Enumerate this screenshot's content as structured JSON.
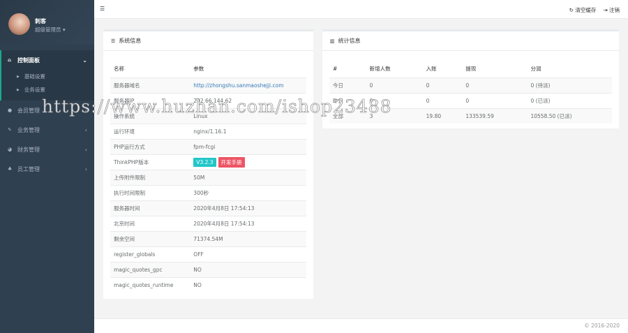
{
  "sidebar": {
    "user_name": "刺客",
    "user_role": "超级管理员 ▾",
    "menu": [
      {
        "label": "控制面板",
        "icon": "home-icon"
      },
      {
        "label": "会员管理",
        "icon": "user-icon"
      },
      {
        "label": "业务管理",
        "icon": "edit-icon"
      },
      {
        "label": "财务管理",
        "icon": "pie-chart-icon"
      },
      {
        "label": "员工管理",
        "icon": "sitemap-icon"
      }
    ],
    "submenu": [
      {
        "label": "基础设置"
      },
      {
        "label": "业务设置"
      }
    ]
  },
  "topbar": {
    "toggle": "☰",
    "clear_cache": "清空缓存",
    "logout": "注销"
  },
  "system_info": {
    "title": "系统信息",
    "headers": [
      "名称",
      "参数"
    ],
    "rows": [
      [
        "服务器域名",
        "http://zhongshu.sanmaoshejji.com"
      ],
      [
        "服务器IP",
        "202.66.144.62"
      ],
      [
        "操作系统",
        "Linux"
      ],
      [
        "运行环境",
        "nginx/1.16.1"
      ],
      [
        "PHP运行方式",
        "fpm-fcgi"
      ],
      [
        "ThinkPHP版本",
        ""
      ],
      [
        "上传附件限制",
        "50M"
      ],
      [
        "执行时间限制",
        "300秒"
      ],
      [
        "服务器时间",
        "2020年4月8日 17:54:13"
      ],
      [
        "北京时间",
        "2020年4月8日 17:54:13"
      ],
      [
        "剩余空间",
        "71374.54M"
      ],
      [
        "register_globals",
        "OFF"
      ],
      [
        "magic_quotes_gpc",
        "NO"
      ],
      [
        "magic_quotes_runtime",
        "NO"
      ]
    ],
    "version_badge": "V3.2.3",
    "manual_badge": "开发手册"
  },
  "stats": {
    "title": "统计信息",
    "headers": [
      "#",
      "新增人数",
      "入账",
      "提现",
      "分润"
    ],
    "rows": [
      [
        "今日",
        "0",
        "0",
        "0",
        "0 (待派)"
      ],
      [
        "昨日",
        "0",
        "0",
        "0",
        "0 (已派)"
      ],
      [
        "全部",
        "3",
        "19.80",
        "133539.59",
        "10558.50 (已派)"
      ]
    ]
  },
  "footer": {
    "copyright": "© 2016-2020"
  },
  "watermark": "https://www.huzhan.com/ishop23488",
  "colors": {
    "sidebar": "#2f4050",
    "accent": "#19aa8d",
    "info": "#23c6c8",
    "danger": "#ed5565",
    "link": "#337ab7"
  }
}
